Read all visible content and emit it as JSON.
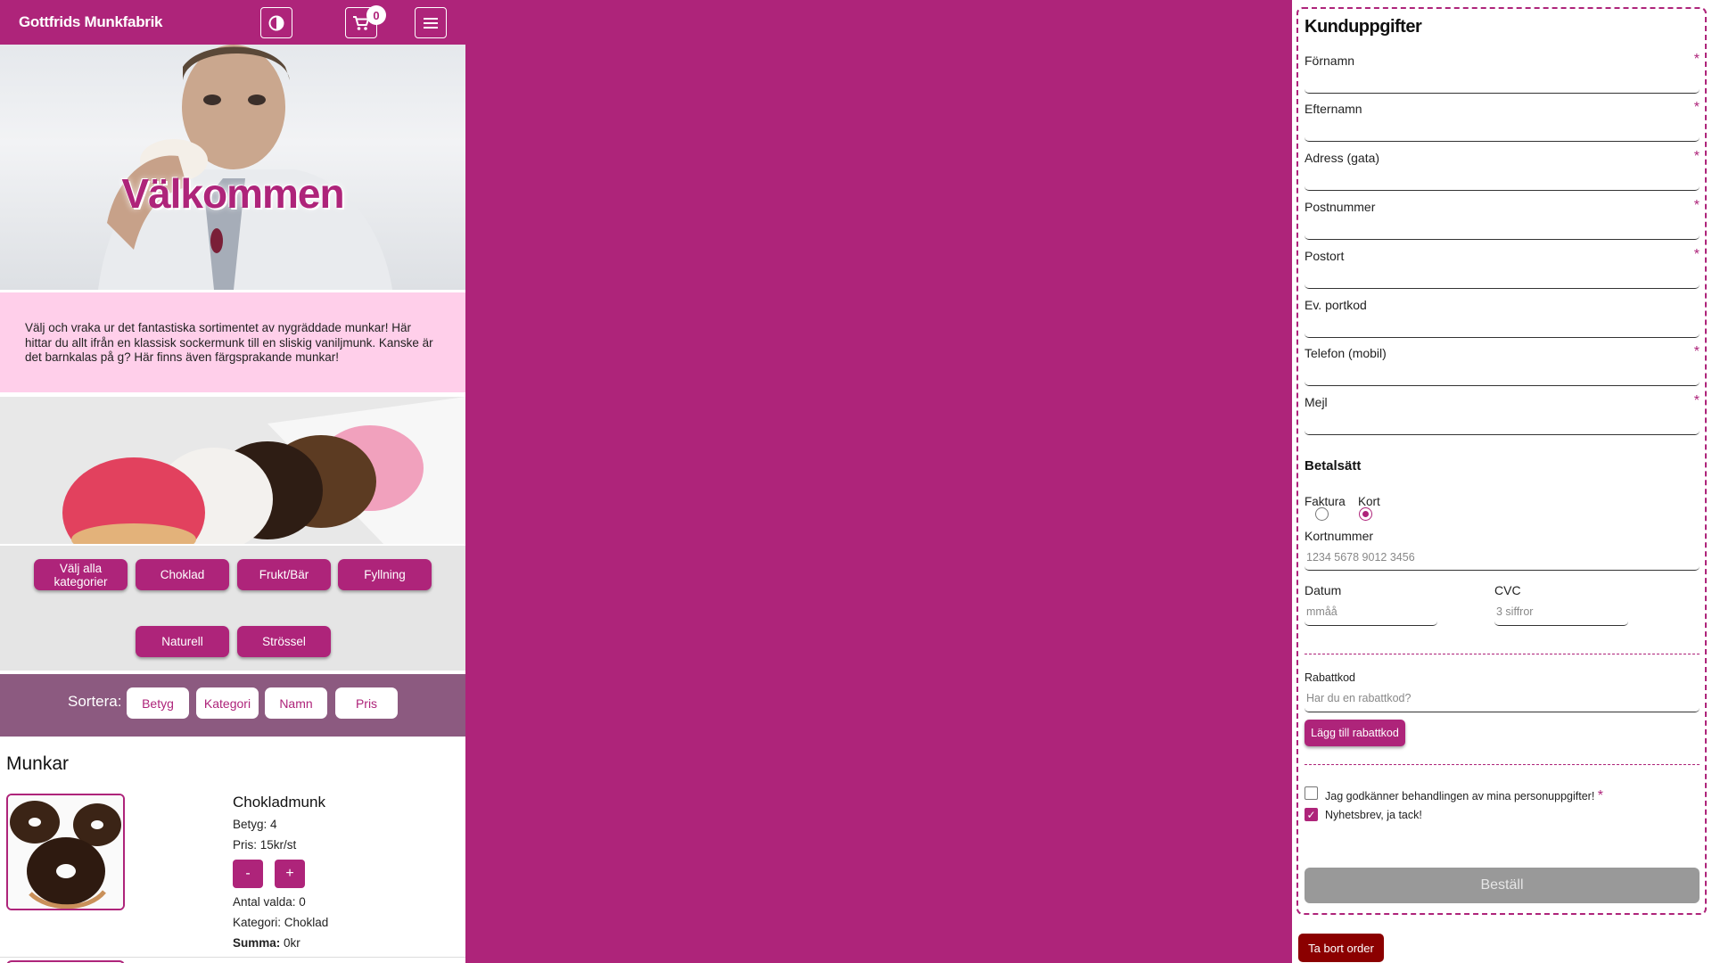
{
  "header": {
    "brand": "Gottfrids Munkfabrik",
    "cart_count": "0"
  },
  "hero": {
    "title": "Välkommen"
  },
  "intro": {
    "text": "Välj och vraka ur det fantastiska sortimentet av nygräddade munkar! Här hittar du allt ifrån en klassisk sockermunk till en sliskig vaniljmunk. Kanske är det barnkalas på g? Här finns även färgsprakande munkar!"
  },
  "filters": {
    "all": "Välj alla kategorier",
    "items": [
      "Choklad",
      "Frukt/Bär",
      "Fyllning",
      "Naturell",
      "Strössel"
    ]
  },
  "sort": {
    "label": "Sortera:",
    "options": [
      "Betyg",
      "Kategori",
      "Namn",
      "Pris"
    ]
  },
  "products": {
    "title": "Munkar",
    "items": [
      {
        "name": "Chokladmunk",
        "rating": "Betyg: 4",
        "price": "Pris: 15kr/st",
        "minus": "-",
        "plus": "+",
        "count": "Antal valda: 0",
        "category": "Kategori: Choklad",
        "sum_label": "Summa:",
        "sum_value": "0kr"
      }
    ]
  },
  "form": {
    "title": "Kunduppgifter",
    "required_mark": "*",
    "fields": {
      "firstname": "Förnamn",
      "lastname": "Efternamn",
      "address": "Adress (gata)",
      "zip": "Postnummer",
      "city": "Postort",
      "doorcode": "Ev. portkod",
      "phone": "Telefon (mobil)",
      "email": "Mejl"
    },
    "payment": {
      "title": "Betalsätt",
      "invoice": "Faktura",
      "card": "Kort",
      "selected": "Kort",
      "card_number_label": "Kortnummer",
      "card_number_placeholder": "1234 5678 9012 3456",
      "date_label": "Datum",
      "date_placeholder": "mmåå",
      "cvc_label": "CVC",
      "cvc_placeholder": "3 siffror"
    },
    "promo": {
      "label": "Rabattkod",
      "placeholder": "Har du en rabattkod?",
      "button": "Lägg till rabattkod"
    },
    "consent": {
      "gdpr": "Jag godkänner behandlingen av mina personuppgifter!",
      "gdpr_checked": false,
      "newsletter": "Nyhetsbrev, ja tack!",
      "newsletter_checked": true,
      "check_mark": "✓"
    },
    "order_button": "Beställ",
    "delete_button": "Ta bort order"
  },
  "colors": {
    "brand": "#ae247a",
    "intro_bg": "#ffcfea",
    "sort_bg": "#8c5a80",
    "order_disabled": "#999999",
    "delete": "#8b0000"
  }
}
